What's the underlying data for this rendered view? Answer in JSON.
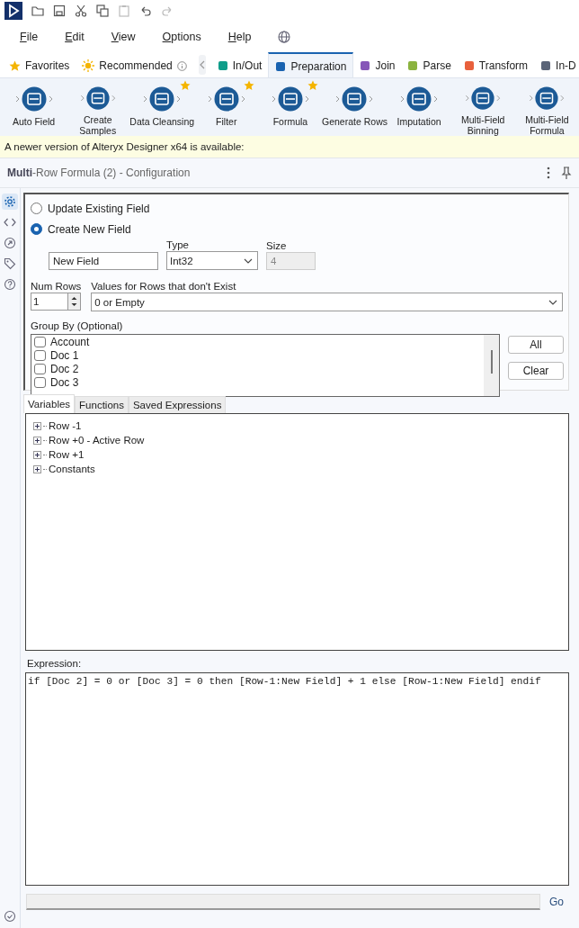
{
  "menu": [
    "File",
    "Edit",
    "View",
    "Options",
    "Help"
  ],
  "quick_tabs": [
    {
      "label": "Favorites",
      "kind": "favorites"
    },
    {
      "label": "Recommended",
      "kind": "recommended"
    }
  ],
  "category_tabs": [
    {
      "label": "In/Out",
      "color": "#0f9d8a",
      "selected": false
    },
    {
      "label": "Preparation",
      "color": "#1a63b0",
      "selected": true
    },
    {
      "label": "Join",
      "color": "#8656b8",
      "selected": false
    },
    {
      "label": "Parse",
      "color": "#8bb33f",
      "selected": false
    },
    {
      "label": "Transform",
      "color": "#e8603c",
      "selected": false
    },
    {
      "label": "In-D",
      "color": "#5a6478",
      "selected": false
    }
  ],
  "tools": [
    {
      "label": "Auto Field",
      "starred": false
    },
    {
      "label": "Create\nSamples",
      "starred": false
    },
    {
      "label": "Data Cleansing",
      "starred": true
    },
    {
      "label": "Filter",
      "starred": true
    },
    {
      "label": "Formula",
      "starred": true
    },
    {
      "label": "Generate Rows",
      "starred": false
    },
    {
      "label": "Imputation",
      "starred": false
    },
    {
      "label": "Multi-Field\nBinning",
      "starred": false
    },
    {
      "label": "Multi-Field\nFormula",
      "starred": false
    }
  ],
  "banner": "A newer version of Alteryx Designer x64 is available:",
  "panel_title": "**Multi**-Row Formula (2) - Configuration",
  "side_nav": [
    {
      "selected": true
    },
    {
      "selected": false
    },
    {
      "selected": false
    },
    {
      "selected": false
    },
    {
      "selected": false
    }
  ],
  "config": {
    "output_mode": [
      {
        "label": "Update Existing Field",
        "selected": false
      },
      {
        "label": "Create New  Field",
        "selected": true
      }
    ],
    "new_field": {
      "value": "New Field"
    },
    "type": {
      "label": "Type",
      "value": "Int32"
    },
    "size": {
      "label": "Size",
      "value": "4",
      "disabled": true
    },
    "num_rows": {
      "label": "Num Rows",
      "value": "1"
    },
    "missing_rows": {
      "label": "Values for Rows that don't Exist",
      "value": "0 or Empty"
    },
    "group_by": {
      "label": "Group By (Optional)",
      "fields": [
        {
          "label": "Account",
          "checked": false
        },
        {
          "label": "Doc 1",
          "checked": false
        },
        {
          "label": "Doc 2",
          "checked": false
        },
        {
          "label": "Doc 3",
          "checked": false
        }
      ]
    },
    "buttons": [
      "All",
      "Clear"
    ]
  },
  "expression_tabs": [
    {
      "label": "Variables",
      "selected": true
    },
    {
      "label": "Functions",
      "selected": false
    },
    {
      "label": "Saved Expressions",
      "selected": false
    }
  ],
  "variables": [
    {
      "label": "Row -1",
      "expanded": false
    },
    {
      "label": "Row +0 - Active Row",
      "expanded": false
    },
    {
      "label": "Row +1",
      "expanded": false
    },
    {
      "label": "Constants",
      "expanded": false
    }
  ],
  "expression": {
    "label": "Expression:",
    "value": "if [Doc 2] = 0 or [Doc 3] = 0 then [Row-1:New Field] + 1 else [Row-1:New Field] endif"
  },
  "progress": {
    "level": 0
  },
  "go_button": "Go"
}
